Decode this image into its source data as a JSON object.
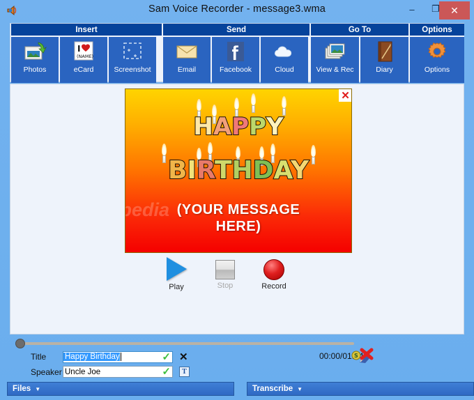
{
  "window": {
    "title": "Sam Voice Recorder - message3.wma",
    "app_icon": "speaker-icon",
    "minimize_label": "–",
    "maximize_label": "❐",
    "close_label": "✕"
  },
  "toolbar": {
    "groups": [
      {
        "name": "Insert",
        "buttons": [
          {
            "label": "Photos",
            "icon": "photos-icon"
          },
          {
            "label": "eCard",
            "icon": "ecard-icon"
          },
          {
            "label": "Screenshot",
            "icon": "screenshot-icon"
          }
        ]
      },
      {
        "name": "Send",
        "buttons": [
          {
            "label": "Email",
            "icon": "email-icon"
          },
          {
            "label": "Facebook",
            "icon": "facebook-icon"
          },
          {
            "label": "Cloud",
            "icon": "cloud-icon"
          }
        ]
      },
      {
        "name": "Go To",
        "buttons": [
          {
            "label": "View & Rec",
            "icon": "photo-stack-icon"
          },
          {
            "label": "Diary",
            "icon": "diary-icon"
          }
        ]
      },
      {
        "name": "Options",
        "buttons": [
          {
            "label": "Options",
            "icon": "gear-icon"
          }
        ]
      }
    ]
  },
  "ecard": {
    "close_label": "✕",
    "heading_line1": "HAPPY",
    "heading_line2": "BIRTHDAY",
    "message_line1": "(YOUR MESSAGE",
    "message_line2": "HERE)",
    "watermark": "Softpedia",
    "letters_line1": [
      {
        "ch": "H",
        "color": "#ffe9a8"
      },
      {
        "ch": "A",
        "color": "#f3a07a"
      },
      {
        "ch": "P",
        "color": "#f07878"
      },
      {
        "ch": "P",
        "color": "#bcd86a"
      },
      {
        "ch": "Y",
        "color": "#fff3bd"
      }
    ],
    "letters_line2": [
      {
        "ch": "B",
        "color": "#f0b64a"
      },
      {
        "ch": "I",
        "color": "#f2e37a"
      },
      {
        "ch": "R",
        "color": "#e87a6a"
      },
      {
        "ch": "T",
        "color": "#cfd86a"
      },
      {
        "ch": "H",
        "color": "#b2cf62"
      },
      {
        "ch": "D",
        "color": "#7fbf55"
      },
      {
        "ch": "A",
        "color": "#d8e070"
      },
      {
        "ch": "Y",
        "color": "#f4d873"
      }
    ]
  },
  "transport": {
    "play_label": "Play",
    "stop_label": "Stop",
    "record_label": "Record",
    "play_icon": "play-triangle-icon",
    "stop_icon": "stop-square-icon",
    "record_icon": "record-circle-icon"
  },
  "form": {
    "title_label": "Title",
    "title_value": "Happy Birthday",
    "title_placeholder": "Title",
    "speaker_label": "Speaker",
    "speaker_value": "Uncle Joe",
    "speaker_placeholder": "Speaker",
    "valid_mark": "✓",
    "clear_title_mark": "✕",
    "speaker_book_icon": "T",
    "time_display": "00:00/01:04",
    "delete_icon": "delete-recording-icon"
  },
  "statusbar": {
    "files_label": "Files",
    "transcribe_label": "Transcribe",
    "caret": "▼"
  },
  "colors": {
    "title_bar": "#6aaeee",
    "group_header": "#06439b",
    "toolbar_button": "#2a64c0",
    "panel_bg": "#eef3fb",
    "status_bar": "#2f69c4",
    "close_button": "#cb5757",
    "accent_check": "#3fbf3f"
  }
}
